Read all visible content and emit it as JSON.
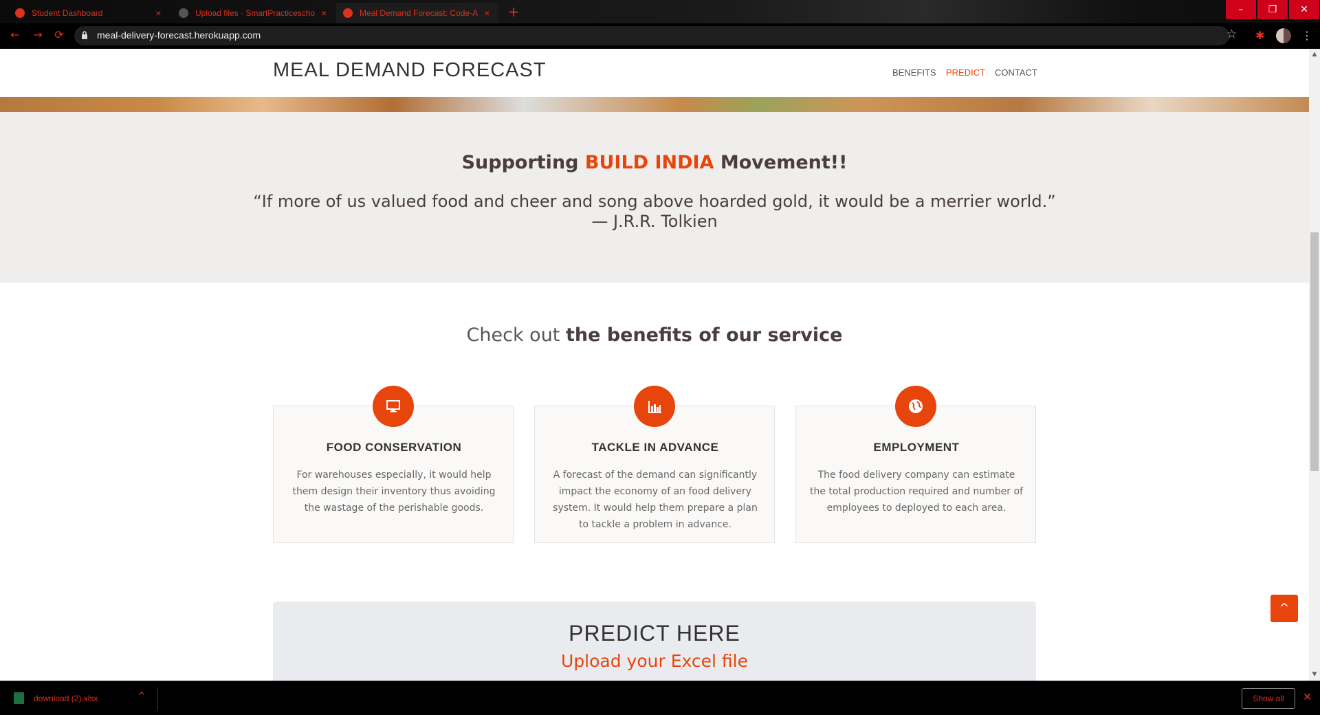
{
  "browser": {
    "tabs": [
      {
        "label": "Student Dashboard",
        "close": "×"
      },
      {
        "label": "Upload files · SmartPracticescho...",
        "close": "×"
      },
      {
        "label": "Meal Demand Forecast: Code-A...",
        "close": "×"
      }
    ],
    "new_tab": "+",
    "url": "meal-delivery-forecast.herokuapp.com",
    "window_buttons": {
      "minimize": "–",
      "restore": "❐",
      "close": "✕"
    },
    "nav": {
      "back": "←",
      "forward": "→",
      "reload": "⟳"
    },
    "star": "☆",
    "extensions": "✱",
    "menu": "⋮"
  },
  "site": {
    "brand": "MEAL DEMAND FORECAST",
    "nav": [
      {
        "label": "BENEFITS"
      },
      {
        "label": "PREDICT",
        "active": true
      },
      {
        "label": "CONTACT"
      }
    ]
  },
  "quote_section": {
    "slogan_prefix": "Supporting ",
    "slogan_accent": "BUILD INDIA",
    "slogan_suffix": " Movement!!",
    "quote": "“If more of us valued food and cheer and song above hoarded gold, it would be a merrier world.”",
    "author": "— J.R.R. Tolkien"
  },
  "benefits": {
    "title_prefix": "Check out ",
    "title_bold": "the benefits of our service",
    "cards": [
      {
        "icon": "monitor-icon",
        "title": "FOOD CONSERVATION",
        "text": "For warehouses especially, it would help them design their inventory thus avoiding the wastage of the perishable goods."
      },
      {
        "icon": "bar-chart-icon",
        "title": "TACKLE IN ADVANCE",
        "text": "A forecast of the demand can significantly impact the economy of an food delivery system. It would help them prepare a plan to tackle a problem in advance."
      },
      {
        "icon": "globe-icon",
        "title": "EMPLOYMENT",
        "text": "The food delivery company can estimate the total production required and number of employees to deployed to each area."
      }
    ]
  },
  "predict": {
    "title": "PREDICT HERE",
    "subtitle": "Upload your Excel file"
  },
  "back_to_top": "^",
  "downloads": {
    "file": "download (2).xlsx",
    "chevron": "^",
    "show_all": "Show all",
    "close": "✕"
  },
  "colors": {
    "accent": "#e8450c",
    "browser_accent": "#e0301e"
  }
}
